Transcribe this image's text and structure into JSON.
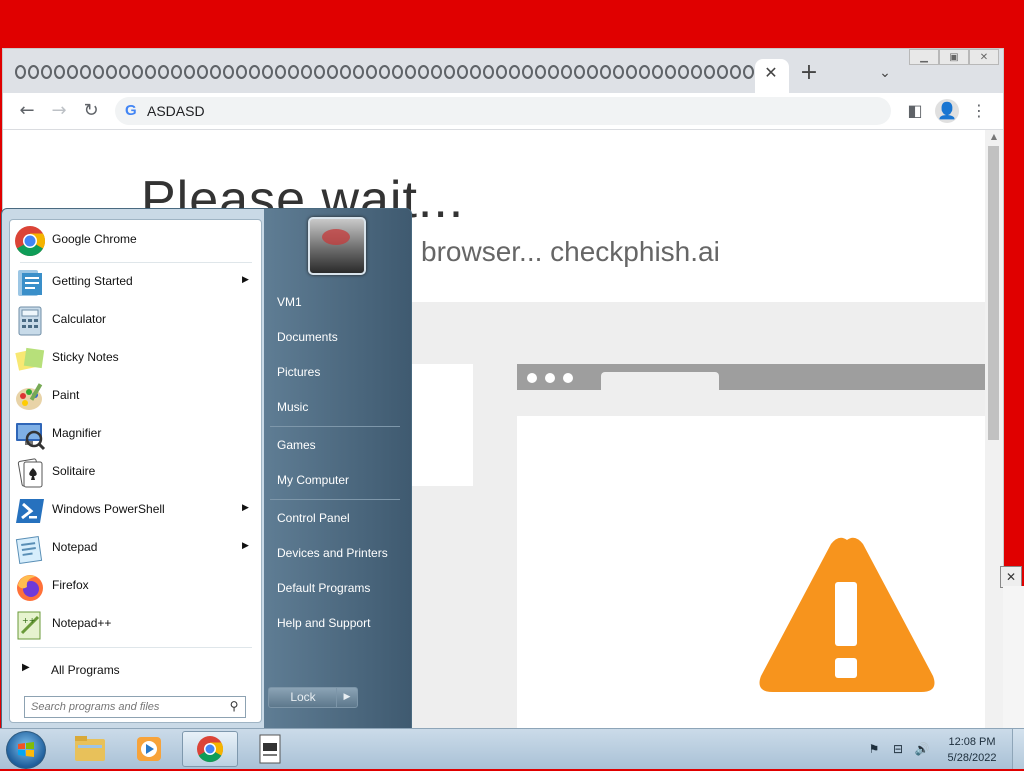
{
  "browser": {
    "address": "ASDASD",
    "tab_close": "✕",
    "new_tab": "+",
    "tab_search": "⌄"
  },
  "page": {
    "heading": "Please wait...",
    "subheading": "browser... checkphish.ai"
  },
  "start_menu": {
    "programs": [
      {
        "label": "Google Chrome",
        "has_submenu": false
      },
      {
        "label": "Getting Started",
        "has_submenu": true
      },
      {
        "label": "Calculator",
        "has_submenu": false
      },
      {
        "label": "Sticky Notes",
        "has_submenu": false
      },
      {
        "label": "Paint",
        "has_submenu": false
      },
      {
        "label": "Magnifier",
        "has_submenu": false
      },
      {
        "label": "Solitaire",
        "has_submenu": false
      },
      {
        "label": "Windows PowerShell",
        "has_submenu": true
      },
      {
        "label": "Notepad",
        "has_submenu": true
      },
      {
        "label": "Firefox",
        "has_submenu": false
      },
      {
        "label": "Notepad++",
        "has_submenu": false
      }
    ],
    "all_programs": "All Programs",
    "search_placeholder": "Search programs and files",
    "right_links": [
      "VM1",
      "Documents",
      "Pictures",
      "Music",
      "Games",
      "My Computer",
      "Control Panel",
      "Devices and Printers",
      "Default Programs",
      "Help and Support"
    ],
    "lock_label": "Lock"
  },
  "taskbar": {
    "time": "12:08 PM",
    "date": "5/28/2022"
  },
  "colors": {
    "desktop": "#e00000",
    "warning": "#f7941d"
  }
}
